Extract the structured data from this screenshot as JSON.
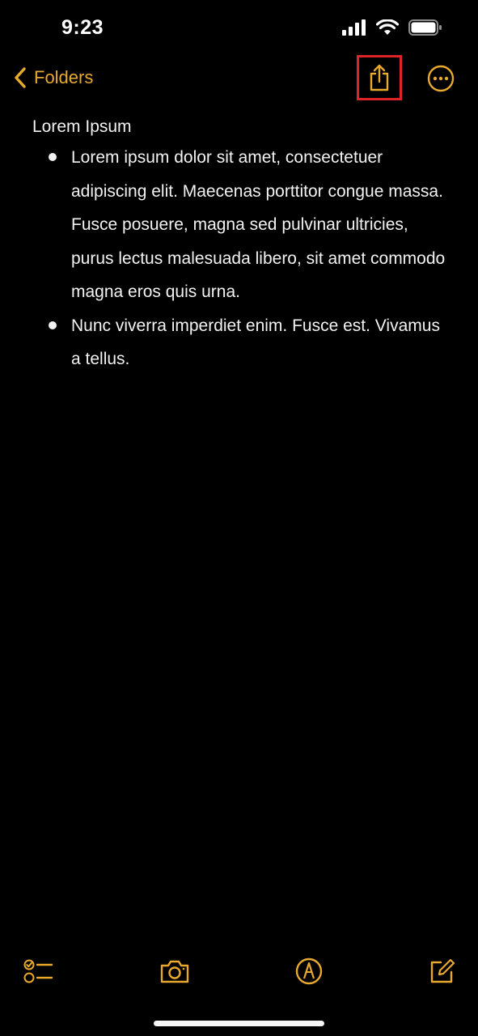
{
  "status_bar": {
    "time": "9:23"
  },
  "nav": {
    "back_label": "Folders",
    "back_icon": "chevron-left-icon",
    "share_icon": "share-icon",
    "more_icon": "ellipsis-circle-icon"
  },
  "note": {
    "title": "Lorem Ipsum",
    "items": [
      "Lorem ipsum dolor sit amet, consectetuer adipiscing elit. Maecenas porttitor congue massa. Fusce posuere, magna sed pulvinar ultricies, purus lectus malesuada libero, sit amet commodo magna eros quis urna.",
      "Nunc viverra imperdiet enim. Fusce est. Vivamus a tellus."
    ]
  },
  "toolbar": {
    "tools": [
      "checklist-icon",
      "camera-icon",
      "markup-icon",
      "compose-icon"
    ]
  },
  "colors": {
    "accent": "#e8a92f",
    "background": "#000000",
    "text": "#f2f2f2",
    "highlight": "#e0222a"
  }
}
